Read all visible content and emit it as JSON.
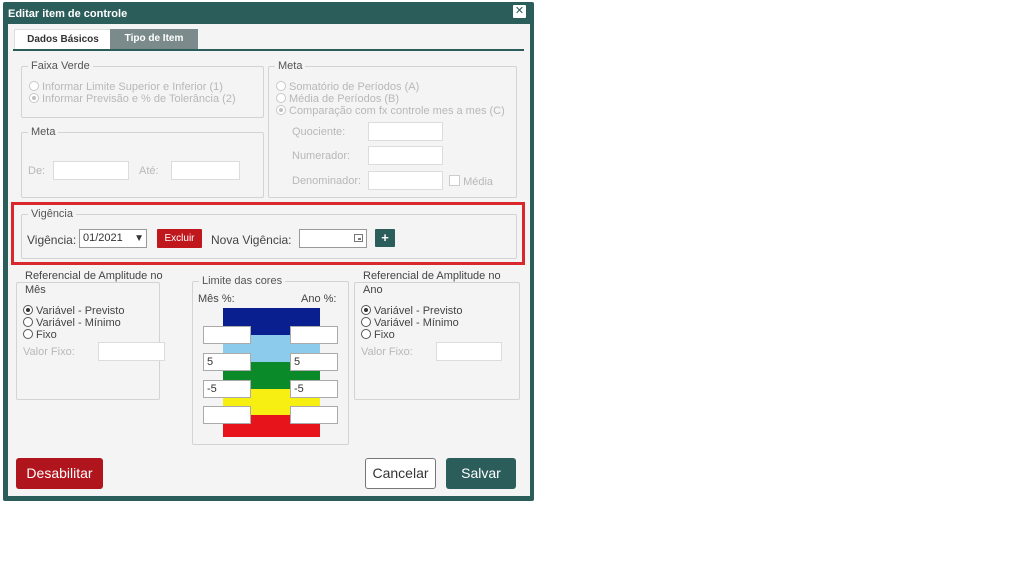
{
  "dialog": {
    "title": "Editar item de controle",
    "close_glyph": "✕"
  },
  "tabs": [
    {
      "label": "Dados Básicos"
    },
    {
      "label": "Tipo de Item"
    }
  ],
  "faixa_verde": {
    "legend": "Faixa Verde",
    "options": [
      {
        "label": "Informar Limite Superior e Inferior (1)",
        "selected": false
      },
      {
        "label": "Informar Previsão e % de Tolerância (2)",
        "selected": true
      }
    ]
  },
  "meta_left": {
    "legend": "Meta",
    "de_label": "De:",
    "ate_label": "Até:"
  },
  "meta_right": {
    "legend": "Meta",
    "options": [
      {
        "label": "Somatório de Períodos (A)",
        "selected": false
      },
      {
        "label": "Média de Períodos (B)",
        "selected": false
      },
      {
        "label": "Comparação com fx controle mes a mes (C)",
        "selected": true
      }
    ],
    "quociente_label": "Quociente:",
    "numerador_label": "Numerador:",
    "denominador_label": "Denominador:",
    "media_label": "Média"
  },
  "vigencia": {
    "legend": "Vigência",
    "label": "Vigência:",
    "selected": "01/2021",
    "excluir_label": "Excluir",
    "nova_label": "Nova Vigência:",
    "nova_value": "",
    "add_label": "+"
  },
  "ref_mes": {
    "legend_line1": "Referencial de Amplitude no",
    "legend_line2": "Mês",
    "options": [
      {
        "label": "Variável - Previsto",
        "selected": true
      },
      {
        "label": "Variável - Mínimo",
        "selected": false
      },
      {
        "label": "Fixo",
        "selected": false
      }
    ],
    "valor_fixo_label": "Valor Fixo:"
  },
  "limite": {
    "legend": "Limite das cores",
    "mes_label": "Mês %:",
    "ano_label": "Ano %:",
    "mes_values": [
      "",
      "5",
      "-5",
      ""
    ],
    "ano_values": [
      "",
      "5",
      "-5",
      ""
    ],
    "band_colors": [
      "#0a1f8f",
      "#8ccbeb",
      "#0b8a2a",
      "#f7ef12",
      "#e8141b"
    ]
  },
  "ref_ano": {
    "legend_line1": "Referencial de Amplitude no",
    "legend_line2": "Ano",
    "options": [
      {
        "label": "Variável - Previsto",
        "selected": true
      },
      {
        "label": "Variável - Mínimo",
        "selected": false
      },
      {
        "label": "Fixo",
        "selected": false
      }
    ],
    "valor_fixo_label": "Valor Fixo:"
  },
  "footer": {
    "desabilitar_label": "Desabilitar",
    "cancelar_label": "Cancelar",
    "salvar_label": "Salvar"
  }
}
